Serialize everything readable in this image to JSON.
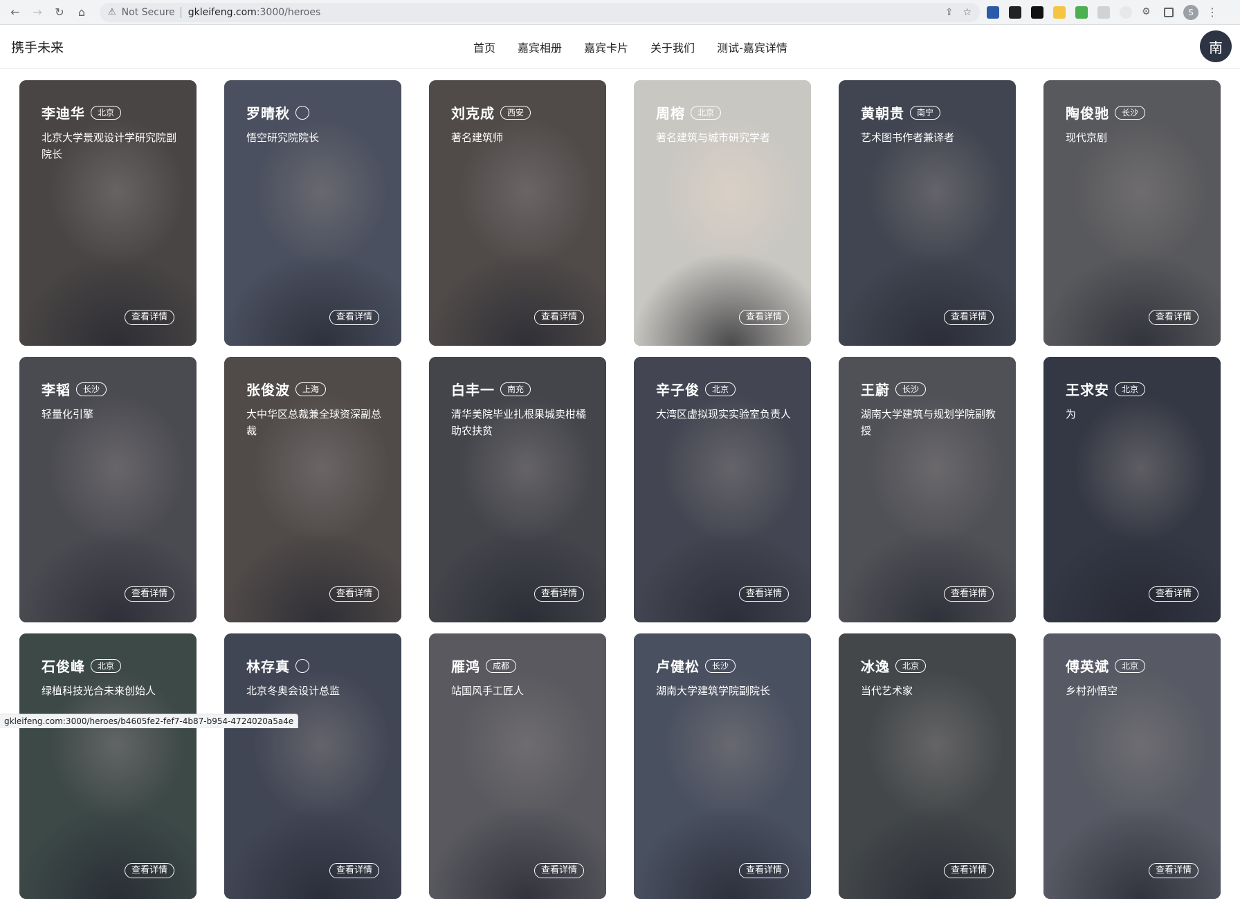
{
  "browser": {
    "security_label": "Not Secure",
    "url_host": "gkleifeng.com",
    "url_path": ":3000/heroes",
    "status_url": "gkleifeng.com:3000/heroes/b4605fe2-fef7-4b87-b954-4724020a5a4e",
    "profile_initial": "S"
  },
  "site": {
    "brand": "携手未来",
    "nav": [
      "首页",
      "嘉宾相册",
      "嘉宾卡片",
      "关于我们",
      "测试-嘉宾详情"
    ],
    "avatar_initial": "南"
  },
  "detail_label": "查看详情",
  "heroes": [
    {
      "name": "李迪华",
      "city": "北京",
      "title": "北京大学景观设计学研究院副院长",
      "color": "#6b5e4a"
    },
    {
      "name": "罗晴秋",
      "city": "",
      "title": "悟空研究院院长",
      "color": "#6d7585"
    },
    {
      "name": "刘克成",
      "city": "西安",
      "title": "著名建筑师",
      "color": "#7a6a55"
    },
    {
      "name": "周榕",
      "city": "北京",
      "title": "著名建筑与城市研究学者",
      "color": "#c9c7c2"
    },
    {
      "name": "黄朝贵",
      "city": "南宁",
      "title": "艺术图书作者兼译者",
      "color": "#595e66"
    },
    {
      "name": "陶俊驰",
      "city": "长沙",
      "title": "现代京剧",
      "color": "#8d8a80"
    },
    {
      "name": "李韬",
      "city": "长沙",
      "title": "轻量化引擎",
      "color": "#6e6a67"
    },
    {
      "name": "张俊波",
      "city": "上海",
      "title": "大中华区总裁兼全球资深副总裁",
      "color": "#7b6a55"
    },
    {
      "name": "白丰一",
      "city": "南充",
      "title": "清华美院毕业扎根果城卖柑橘助农扶贫",
      "color": "#5e5d58"
    },
    {
      "name": "辛子俊",
      "city": "北京",
      "title": "大湾区虚拟现实实验室负责人",
      "color": "#5e6068"
    },
    {
      "name": "王蔚",
      "city": "长沙",
      "title": "湖南大学建筑与规划学院副教授",
      "color": "#7a7872"
    },
    {
      "name": "王求安",
      "city": "北京",
      "title": "为",
      "color": "#3c4049"
    },
    {
      "name": "石俊峰",
      "city": "北京",
      "title": "绿植科技光合未来创始人",
      "color": "#4f6650"
    },
    {
      "name": "林存真",
      "city": "",
      "title": "北京冬奥会设计总监",
      "color": "#5a6070"
    },
    {
      "name": "雁鸿",
      "city": "成都",
      "title": "站国风手工匠人",
      "color": "#8e8a85"
    },
    {
      "name": "卢健松",
      "city": "长沙",
      "title": "湖南大学建筑学院副院长",
      "color": "#6b7688"
    },
    {
      "name": "冰逸",
      "city": "北京",
      "title": "当代艺术家",
      "color": "#5e6356"
    },
    {
      "name": "傅英斌",
      "city": "北京",
      "title": "乡村孙悟空",
      "color": "#8a8c90"
    }
  ]
}
